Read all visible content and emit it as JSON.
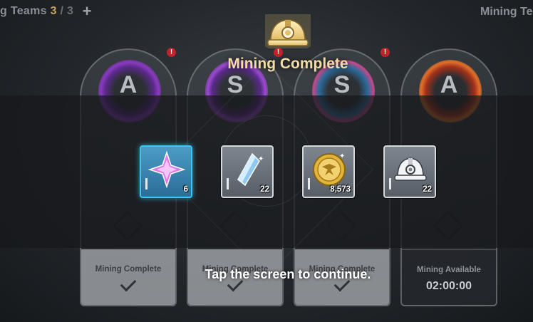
{
  "topbar": {
    "teams_label": "g Teams",
    "teams_current": "3",
    "teams_sep": "/",
    "teams_max": "3",
    "add_label": "+",
    "mining_label": "Mining Te"
  },
  "popup": {
    "title": "Mining Complete",
    "tap_hint": "Tap the screen to continue."
  },
  "rewards": [
    {
      "icon": "purple-crystal-icon",
      "quantity": "6"
    },
    {
      "icon": "blue-crystal-icon",
      "quantity": "22"
    },
    {
      "icon": "gold-coin-icon",
      "quantity": "8,573"
    },
    {
      "icon": "miner-helmet-icon",
      "quantity": "22"
    }
  ],
  "cards": [
    {
      "grade": "A",
      "status": "Mining Complete",
      "alert": "!"
    },
    {
      "grade": "S",
      "status": "Mining Complete",
      "alert": "!"
    },
    {
      "grade": "S",
      "status": "Mining Complete",
      "alert": "!"
    },
    {
      "grade": "A",
      "status": "Mining Available",
      "timer": "02:00:00"
    }
  ],
  "colors": {
    "accent_gold": "#f3dca6",
    "selected_border": "#35c8f0",
    "alert_red": "#c0232a"
  }
}
